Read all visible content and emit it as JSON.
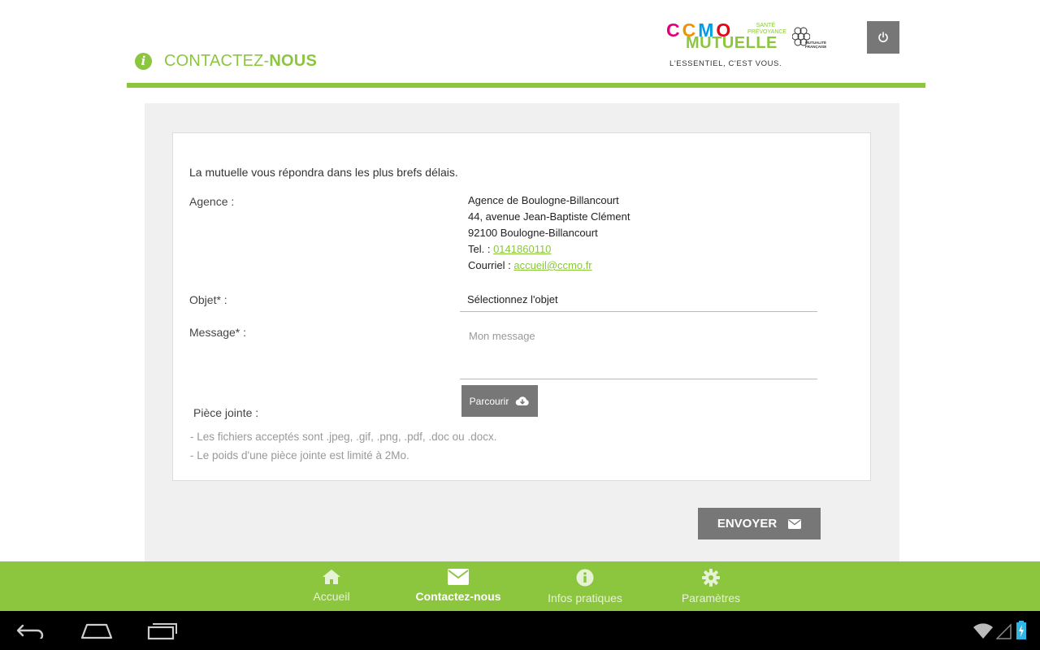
{
  "header": {
    "title_prefix": "CONTACTEZ-",
    "title_bold": "NOUS",
    "logo": {
      "ccmo": "CCMO",
      "sante": "SANTÉ",
      "prevoyance": "PRÉVOYANCE",
      "mutuelle": "MUTUELLE",
      "slogan": "L'ESSENTIEL, C'EST VOUS.",
      "mf_line1": "MUTUALITÉ",
      "mf_line2": "FRANÇAISE"
    }
  },
  "form": {
    "intro": "La mutuelle vous répondra dans les plus brefs délais.",
    "agence_label": "Agence :",
    "agence_name": "Agence de Boulogne-Billancourt",
    "agence_address": "44, avenue Jean-Baptiste Clément",
    "agence_city": "92100 Boulogne-Billancourt",
    "tel_label": "Tel. : ",
    "tel_value": "0141860110",
    "courriel_label": "Courriel : ",
    "courriel_value": "accueil@ccmo.fr",
    "objet_label": "Objet* :",
    "objet_selected": "Sélectionnez l'objet",
    "message_label": "Message* :",
    "message_placeholder": "Mon message",
    "piece_label": "Pièce jointe :",
    "browse_label": "Parcourir",
    "note1": "- Les fichiers acceptés sont .jpeg, .gif, .png, .pdf, .doc ou .docx.",
    "note2": "- Le poids d'une pièce jointe est limité à 2Mo.",
    "send_label": "ENVOYER"
  },
  "tabs": [
    {
      "label": "Accueil",
      "icon": "home-icon",
      "active": false
    },
    {
      "label": "Contactez-nous",
      "icon": "envelope-icon",
      "active": true
    },
    {
      "label": "Infos pratiques",
      "icon": "info-icon",
      "active": false
    },
    {
      "label": "Paramètres",
      "icon": "gear-icon",
      "active": false
    }
  ],
  "colors": {
    "accent": "#8cc63f",
    "button": "#777777",
    "panel": "#f0f0f0"
  }
}
